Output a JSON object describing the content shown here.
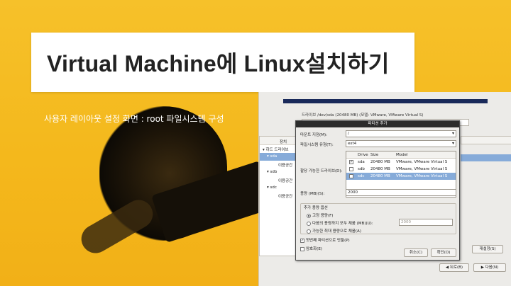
{
  "slide": {
    "title": "Virtual Machine에 Linux설치하기",
    "subtitle": "사용자 레이아웃 설정 화면 : root 파일시스템 구성"
  },
  "installer": {
    "drive_info": "드라이브 /dev/sda (20480 MB) (모델: VMware, VMware Virtual S)",
    "tree_header": "장치",
    "tree": [
      {
        "label": "▾ 하드 드라이브",
        "selected": false
      },
      {
        "label": "▾ sda",
        "selected": true
      },
      {
        "label": "이용공간",
        "selected": false
      },
      {
        "label": "▾ sdb",
        "selected": false
      },
      {
        "label": "이용공간",
        "selected": false
      },
      {
        "label": "▾ sdc",
        "selected": false
      },
      {
        "label": "이용공간",
        "selected": false
      }
    ],
    "buttons": {
      "reset": "재설정(S)",
      "back": "뒤로(B)",
      "next": "다음(N)"
    }
  },
  "dialog": {
    "title": "파티션 추가",
    "mount_label": "마운트 지점(M):",
    "mount_value": "/",
    "fs_label": "파일시스템 유형(T):",
    "fs_value": "ext4",
    "drives_label": "할당 가능한 드라이브(D):",
    "table_headers": {
      "drive": "Drive",
      "size": "Size",
      "model": "Model"
    },
    "drives": [
      {
        "name": "sda",
        "size": "20480 MB",
        "model": "VMware, VMware Virtual S",
        "checked": true,
        "selected": false
      },
      {
        "name": "sdb",
        "size": "20480 MB",
        "model": "VMware, VMware Virtual S",
        "checked": false,
        "selected": false
      },
      {
        "name": "sdc",
        "size": "20480 MB",
        "model": "VMware, VMware Virtual S",
        "checked": false,
        "selected": true
      }
    ],
    "size_label": "용량 (MB)(S):",
    "size_value": "2000",
    "options_label": "추가 용량 옵션",
    "opt_fixed": "고정 용량(F)",
    "opt_upto": "다음의 용량까지 모두 채움 (MB)(U):",
    "opt_upto_value": "2000",
    "opt_max": "가능한 최대 용량으로 채움(A)",
    "primary": "첫번째 파티션으로 만듦(P)",
    "encrypt": "암호화(E)",
    "cancel": "취소(C)",
    "ok": "확인(O)"
  }
}
